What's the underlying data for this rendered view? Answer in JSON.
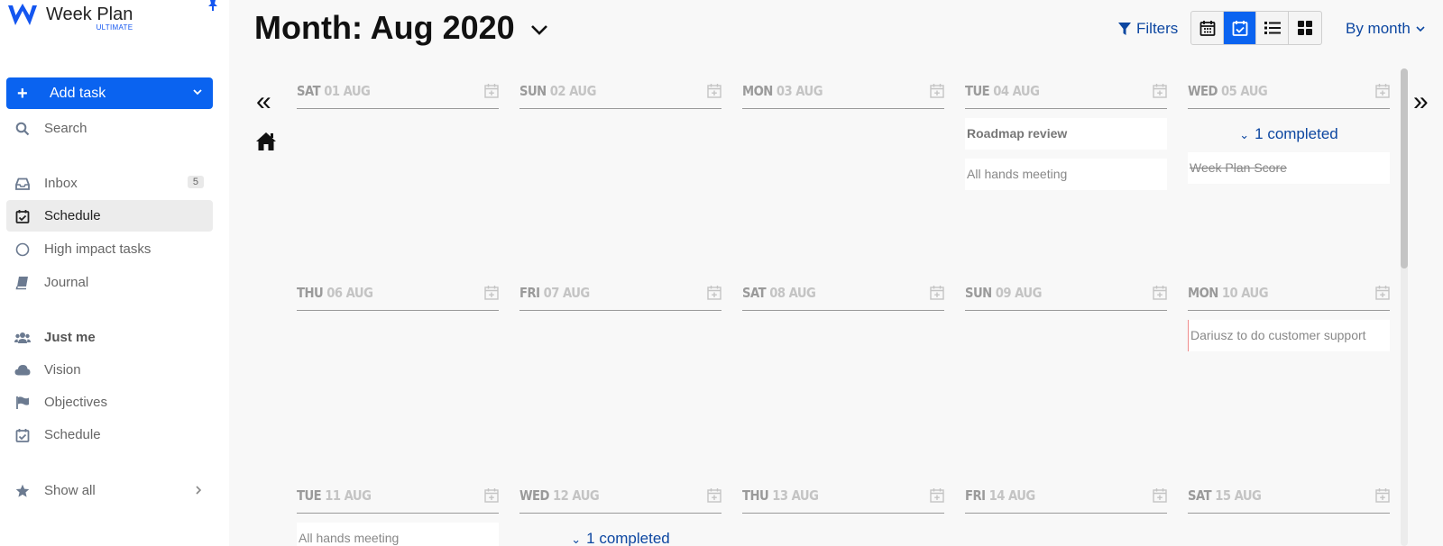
{
  "app": {
    "title": "Week Plan",
    "subtitle": "ULTIMATE"
  },
  "sidebar": {
    "add_task": "Add task",
    "search": "Search",
    "inbox": "Inbox",
    "inbox_count": "5",
    "schedule": "Schedule",
    "high_impact": "High impact tasks",
    "journal": "Journal",
    "just_me": "Just me",
    "vision": "Vision",
    "objectives": "Objectives",
    "schedule2": "Schedule",
    "show_all": "Show all"
  },
  "header": {
    "title": "Month: Aug 2020",
    "filters": "Filters",
    "by_month": "By month"
  },
  "nav": {
    "prev": "«",
    "next": "»"
  },
  "days": [
    {
      "dow": "SAT",
      "date": "01 AUG",
      "completed": "",
      "tasks": []
    },
    {
      "dow": "SUN",
      "date": "02 AUG",
      "completed": "",
      "tasks": []
    },
    {
      "dow": "MON",
      "date": "03 AUG",
      "completed": "",
      "tasks": []
    },
    {
      "dow": "TUE",
      "date": "04 AUG",
      "completed": "",
      "tasks": [
        {
          "text": "Roadmap review",
          "style": "bold"
        },
        {
          "text": "All hands meeting",
          "style": ""
        }
      ]
    },
    {
      "dow": "WED",
      "date": "05 AUG",
      "completed": "1 completed",
      "tasks": [
        {
          "text": "Week Plan Score",
          "style": "done"
        }
      ]
    },
    {
      "dow": "THU",
      "date": "06 AUG",
      "completed": "",
      "tasks": []
    },
    {
      "dow": "FRI",
      "date": "07 AUG",
      "completed": "",
      "tasks": []
    },
    {
      "dow": "SAT",
      "date": "08 AUG",
      "completed": "",
      "tasks": []
    },
    {
      "dow": "SUN",
      "date": "09 AUG",
      "completed": "",
      "tasks": []
    },
    {
      "dow": "MON",
      "date": "10 AUG",
      "completed": "",
      "tasks": [
        {
          "text": "Dariusz to do customer support",
          "style": "red"
        }
      ]
    },
    {
      "dow": "TUE",
      "date": "11 AUG",
      "completed": "",
      "tasks": [
        {
          "text": "All hands meeting",
          "style": ""
        }
      ]
    },
    {
      "dow": "WED",
      "date": "12 AUG",
      "completed": "1 completed",
      "tasks": []
    },
    {
      "dow": "THU",
      "date": "13 AUG",
      "completed": "",
      "tasks": []
    },
    {
      "dow": "FRI",
      "date": "14 AUG",
      "completed": "",
      "tasks": []
    },
    {
      "dow": "SAT",
      "date": "15 AUG",
      "completed": "",
      "tasks": []
    }
  ],
  "colors": {
    "accent": "#0a63f0",
    "link": "#0d47a1"
  }
}
